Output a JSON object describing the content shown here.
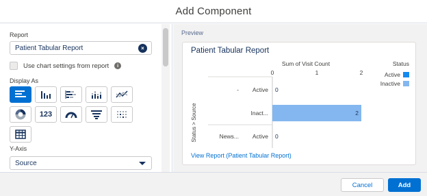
{
  "modal": {
    "title": "Add Component"
  },
  "left": {
    "report_label": "Report",
    "report_value": "Patient Tabular Report",
    "chart_settings_label": "Use chart settings from report",
    "display_as_label": "Display As",
    "display_types": [
      {
        "icon": "horizontal-bar-chart-icon",
        "selected": true
      },
      {
        "icon": "vertical-bar-chart-icon",
        "selected": false
      },
      {
        "icon": "stacked-horizontal-bar-icon",
        "selected": false
      },
      {
        "icon": "stacked-vertical-bar-icon",
        "selected": false
      },
      {
        "icon": "line-chart-icon",
        "selected": false
      },
      {
        "icon": "donut-chart-icon",
        "selected": false
      },
      {
        "icon": "metric-icon",
        "text": "123",
        "selected": false
      },
      {
        "icon": "gauge-icon",
        "selected": false
      },
      {
        "icon": "funnel-icon",
        "selected": false
      },
      {
        "icon": "scatter-icon",
        "selected": false
      },
      {
        "icon": "table-icon",
        "selected": false
      }
    ],
    "yaxis_label": "Y-Axis",
    "yaxis_value": "Source"
  },
  "preview": {
    "label": "Preview",
    "card_title": "Patient Tabular Report",
    "view_report_link": "View Report (Patient Tabular Report)"
  },
  "chart_data": {
    "type": "bar",
    "orientation": "horizontal",
    "title": "Sum of Visit Count",
    "ylabel": "Status > Source",
    "xlim": [
      0,
      2
    ],
    "xticks": [
      "0",
      "1",
      "2"
    ],
    "rows": [
      {
        "group": "-",
        "category": "Active",
        "value": 0,
        "series": "Active"
      },
      {
        "group": "",
        "category": "Inact...",
        "value": 2,
        "series": "Inactive"
      },
      {
        "group": "News...",
        "category": "Active",
        "value": 0,
        "series": "Active"
      }
    ],
    "legend": {
      "title": "Status",
      "placement": "right",
      "items": [
        {
          "name": "Active",
          "color": "#1589ee"
        },
        {
          "name": "Inactive",
          "color": "#84b7ef"
        }
      ]
    }
  },
  "footer": {
    "cancel_label": "Cancel",
    "add_label": "Add"
  },
  "colors": {
    "brand": "#0070d2",
    "text": "#16325c"
  }
}
